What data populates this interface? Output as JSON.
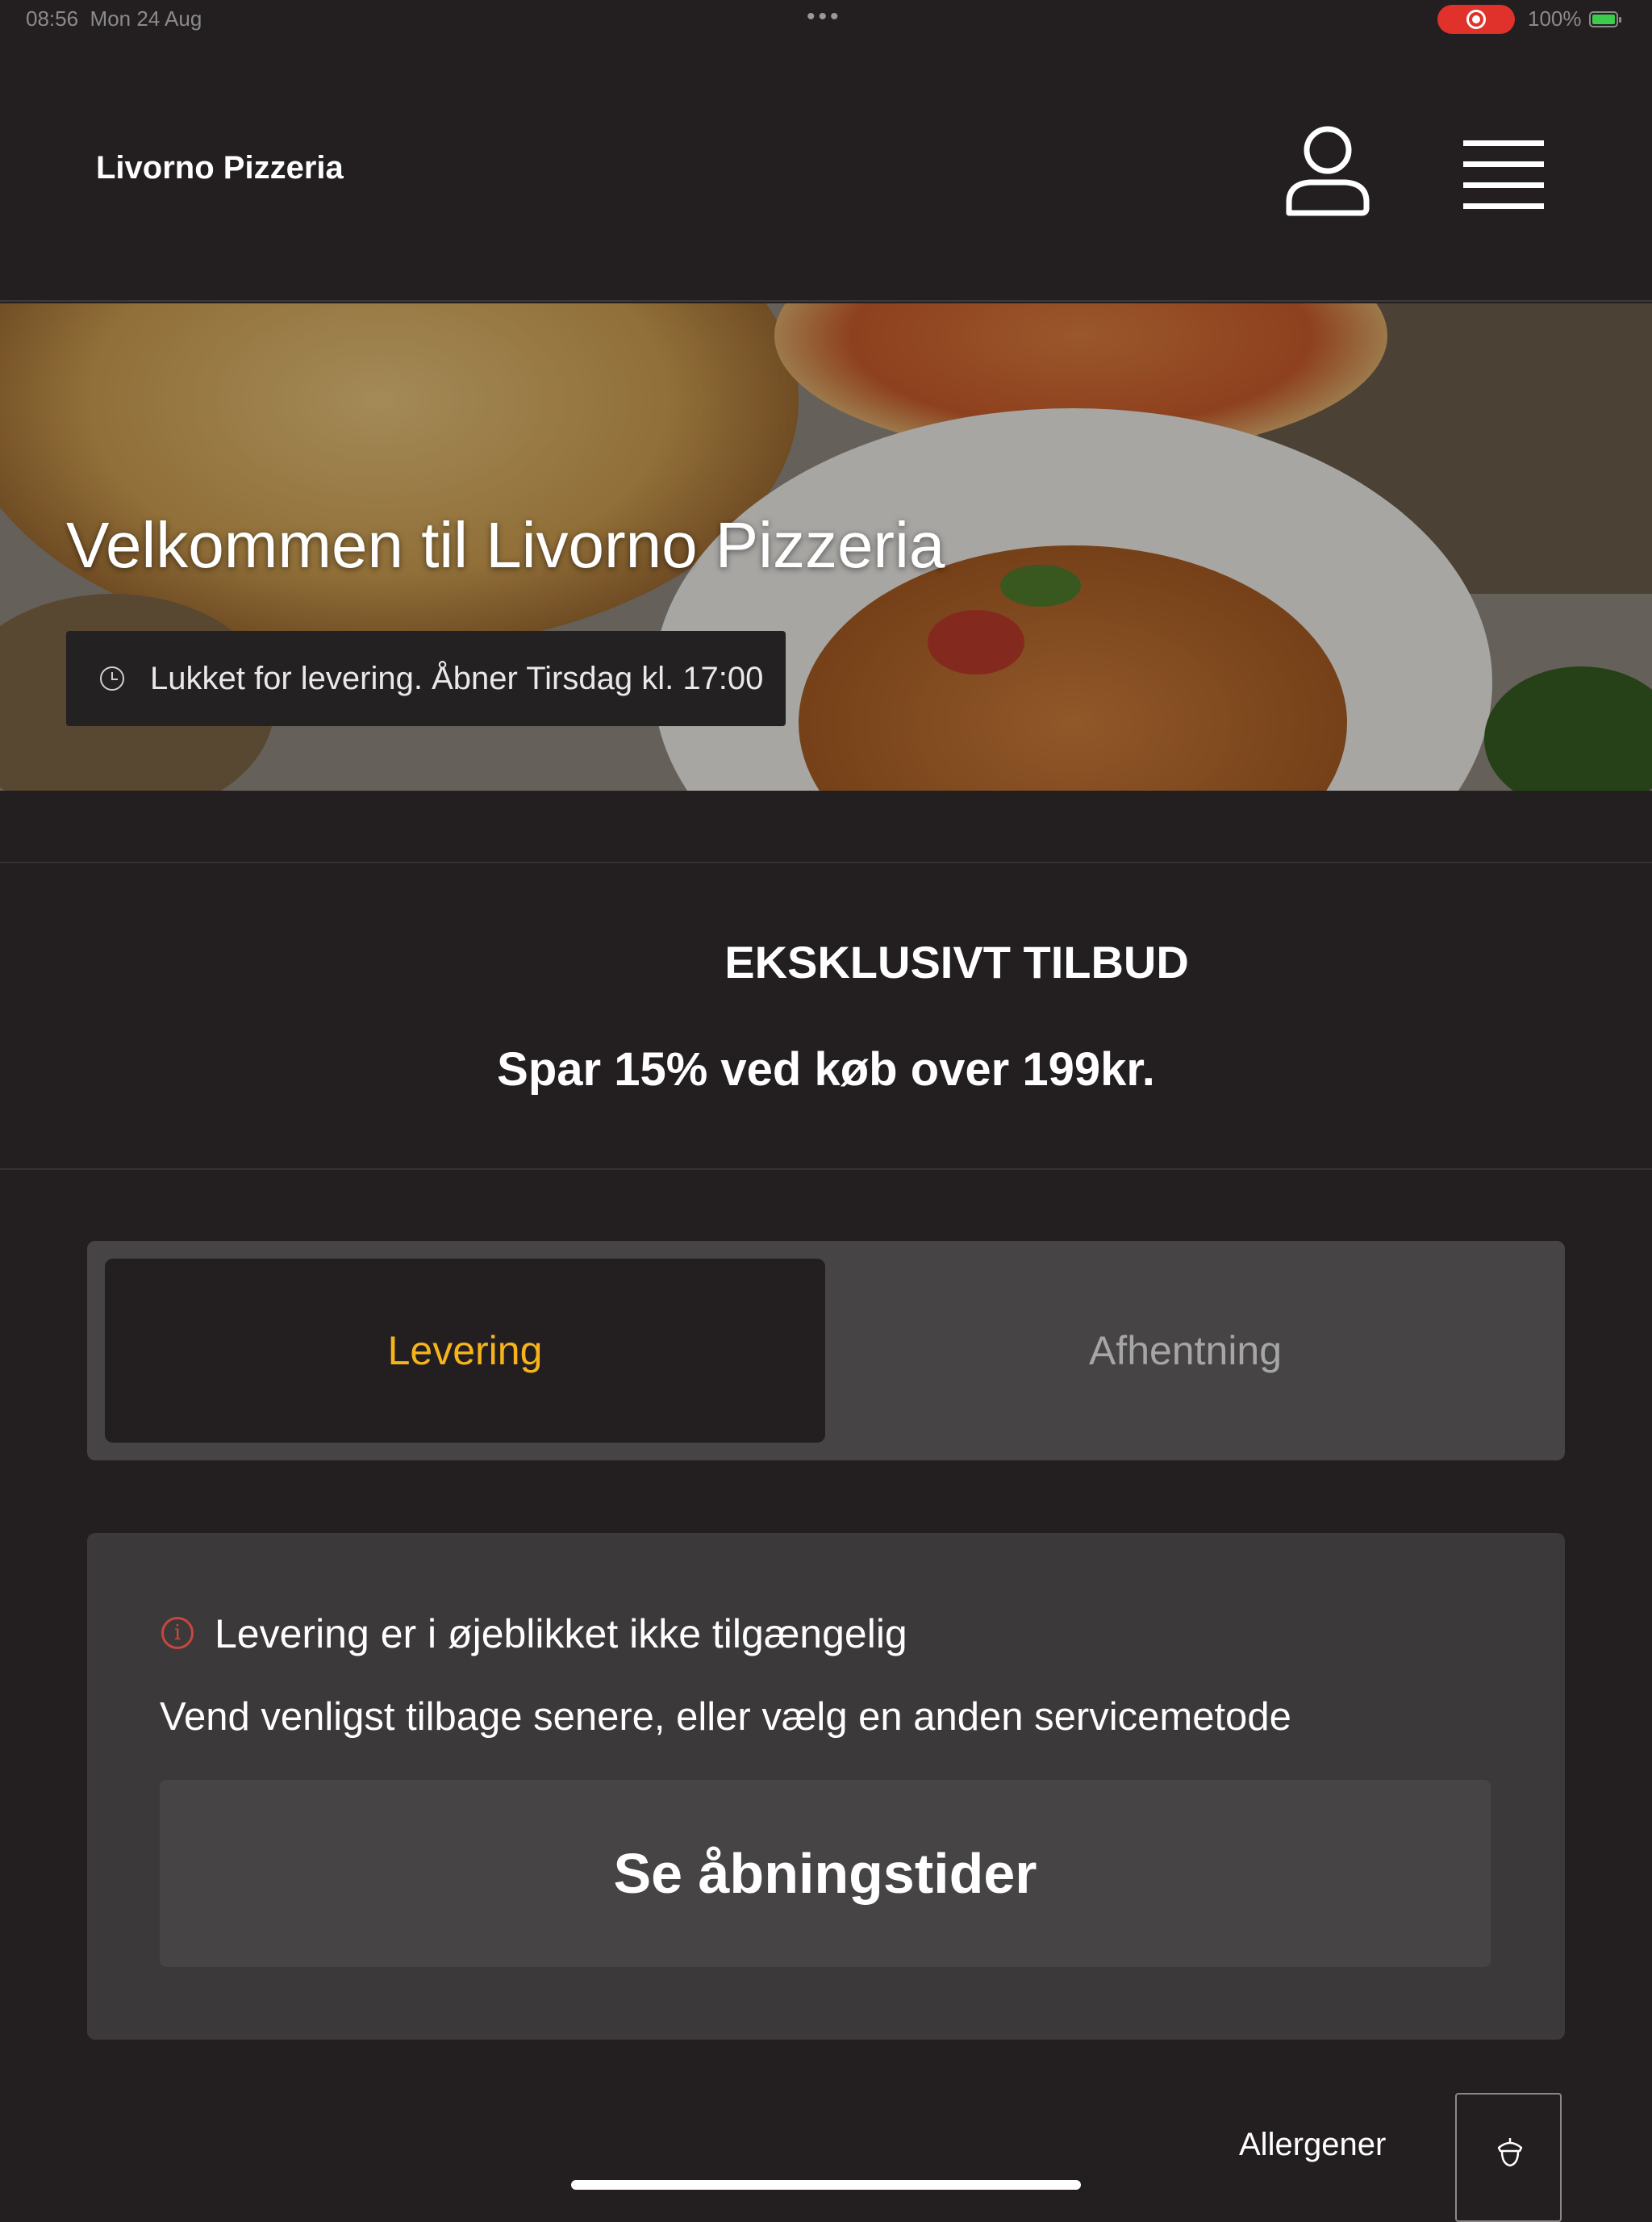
{
  "status_bar": {
    "time": "08:56",
    "date": "Mon 24 Aug",
    "more": "•••",
    "battery_text": "100%"
  },
  "header": {
    "brand": "Livorno Pizzeria",
    "icons": [
      "user-icon",
      "hamburger-menu-icon"
    ]
  },
  "hero": {
    "title": "Velkommen til Livorno Pizzeria",
    "status_text": "Lukket for levering. Åbner Tirsdag kl. 17:00",
    "status_icon": "clock-icon"
  },
  "offer": {
    "title": "EKSKLUSIVT TILBUD",
    "text": "Spar 15% ved køb over 199kr."
  },
  "service_toggle": {
    "options": [
      {
        "label": "Levering",
        "selected": true
      },
      {
        "label": "Afhentning",
        "selected": false
      }
    ],
    "accent_color": "#f6b31c"
  },
  "notice": {
    "icon": "info-alert-icon",
    "heading": "Levering er i øjeblikket ikke tilgængelig",
    "description": "Vend venligst tilbage senere, eller vælg en anden servicemetode",
    "button_label": "Se åbningstider"
  },
  "footer": {
    "allergen_label": "Allergener",
    "allergen_icon": "acorn-icon"
  }
}
